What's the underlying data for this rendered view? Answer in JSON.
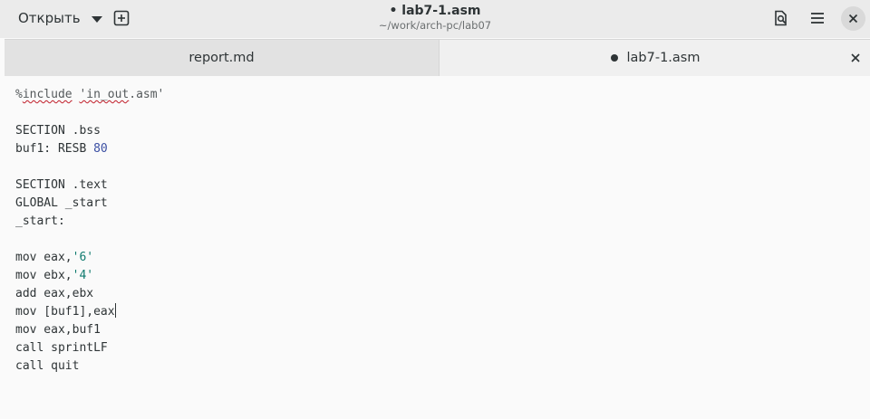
{
  "header": {
    "open_label": "Открыть",
    "title": "• lab7-1.asm",
    "subtitle": "~/work/arch-pc/lab07",
    "icons": [
      "new-tab-icon",
      "document-search-icon",
      "hamburger-menu-icon",
      "close-icon"
    ]
  },
  "tabs": [
    {
      "label": "report.md",
      "active": false,
      "modified": false
    },
    {
      "label": "lab7-1.asm",
      "active": true,
      "modified": true
    }
  ],
  "editor": {
    "lines": [
      {
        "parts": [
          {
            "t": "%",
            "c": "pp"
          },
          {
            "t": "include",
            "c": "pp squiggle"
          },
          {
            "t": " ",
            "c": "pp"
          },
          {
            "t": "'in_out",
            "c": "pp squiggle"
          },
          {
            "t": ".asm'",
            "c": "pp"
          }
        ]
      },
      {
        "parts": []
      },
      {
        "parts": [
          {
            "t": "SECTION .bss",
            "c": ""
          }
        ]
      },
      {
        "parts": [
          {
            "t": "buf1: RESB ",
            "c": ""
          },
          {
            "t": "80",
            "c": "num"
          }
        ]
      },
      {
        "parts": []
      },
      {
        "parts": [
          {
            "t": "SECTION .text",
            "c": ""
          }
        ]
      },
      {
        "parts": [
          {
            "t": "GLOBAL _start",
            "c": ""
          }
        ]
      },
      {
        "parts": [
          {
            "t": "_start:",
            "c": ""
          }
        ]
      },
      {
        "parts": []
      },
      {
        "parts": [
          {
            "t": "mov eax,",
            "c": ""
          },
          {
            "t": "'6'",
            "c": "str"
          }
        ]
      },
      {
        "parts": [
          {
            "t": "mov ebx,",
            "c": ""
          },
          {
            "t": "'4'",
            "c": "str"
          }
        ]
      },
      {
        "parts": [
          {
            "t": "add eax,ebx",
            "c": ""
          }
        ]
      },
      {
        "parts": [
          {
            "t": "mov [buf1],eax",
            "c": ""
          }
        ],
        "cursor": true
      },
      {
        "parts": [
          {
            "t": "mov eax,buf1",
            "c": ""
          }
        ]
      },
      {
        "parts": [
          {
            "t": "call sprintLF",
            "c": ""
          }
        ]
      },
      {
        "parts": [
          {
            "t": "call quit",
            "c": ""
          }
        ]
      }
    ]
  }
}
